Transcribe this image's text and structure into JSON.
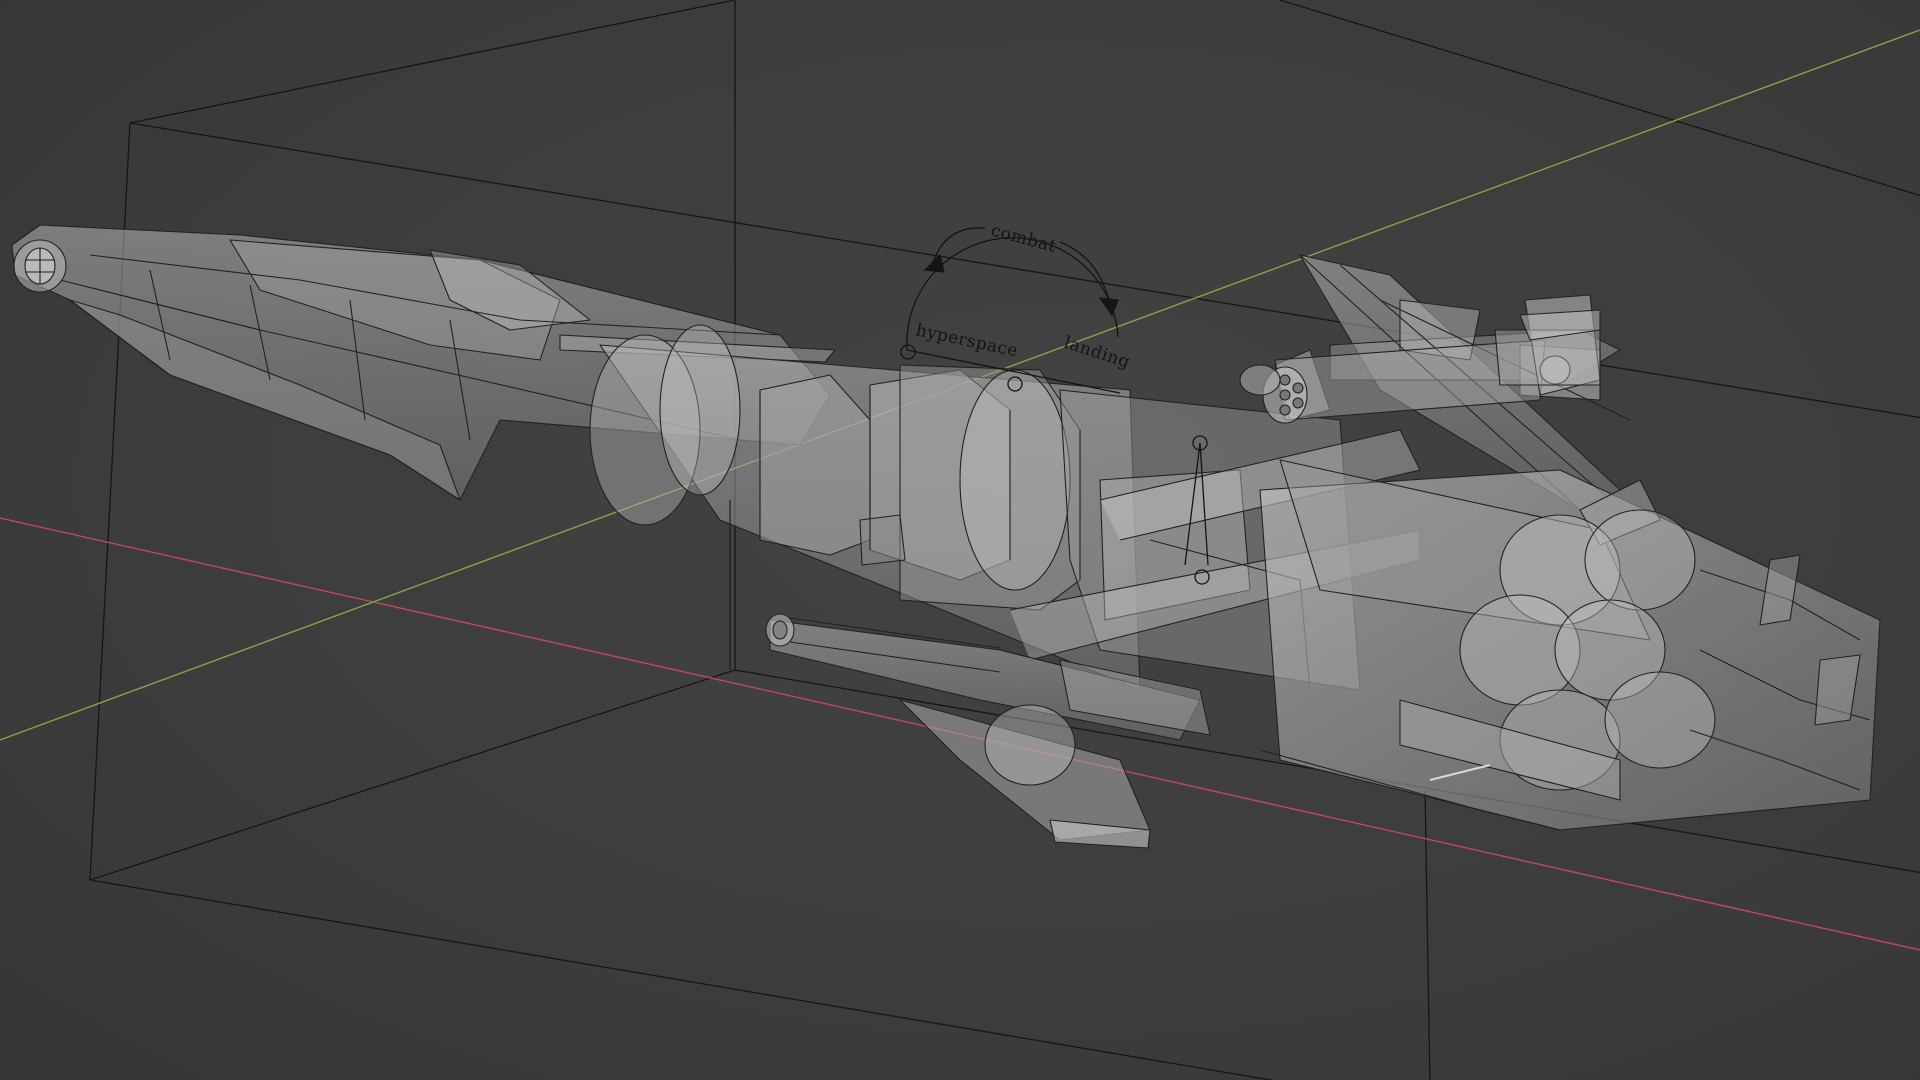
{
  "viewport": {
    "background_color": "#3d3d3d",
    "wire_color": "#1a1a1a",
    "mesh_fill_color": "#9a9a9a",
    "axis_x_color": "#c0485a",
    "axis_y_color": "#7fa845"
  },
  "rig": {
    "top_label": "combat",
    "left_label": "hyperspace",
    "right_label": "landing"
  }
}
